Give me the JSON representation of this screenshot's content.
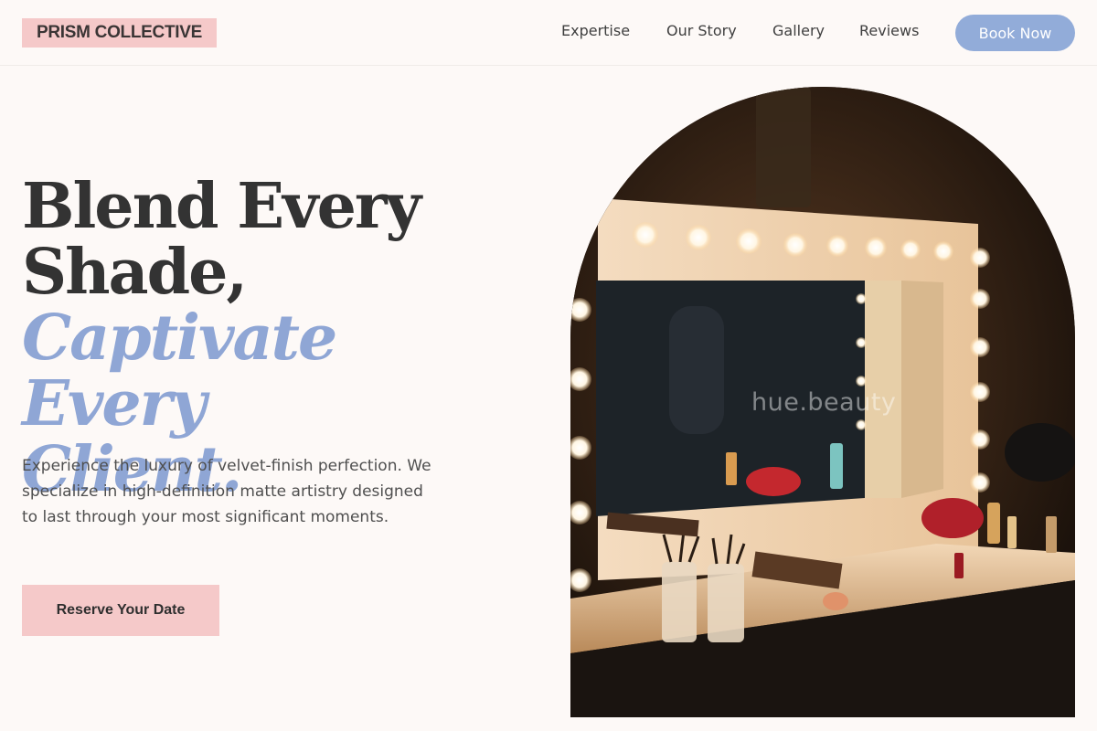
{
  "brand": {
    "name": "PRISM COLLECTIVE"
  },
  "nav": {
    "links": [
      "Expertise",
      "Our Story",
      "Gallery",
      "Reviews"
    ],
    "cta_label": "Book Now"
  },
  "hero": {
    "headline_dark_1": "Blend Every",
    "headline_dark_2": "Shade,",
    "headline_accent_1": "Captivate Every",
    "headline_accent_2": "Client.",
    "intro": "Experience the luxury of velvet-finish perfection. We specialize in high-definition matte artistry designed to last through your most significant moments.",
    "cta_label": "Reserve Your Date",
    "image_watermark": "hue.beauty"
  },
  "colors": {
    "background": "#fdf9f7",
    "logo_bg": "#f5c9c9",
    "accent_blue": "#8fa6d5",
    "button_blue": "#92acd9",
    "text_dark": "#333333"
  }
}
